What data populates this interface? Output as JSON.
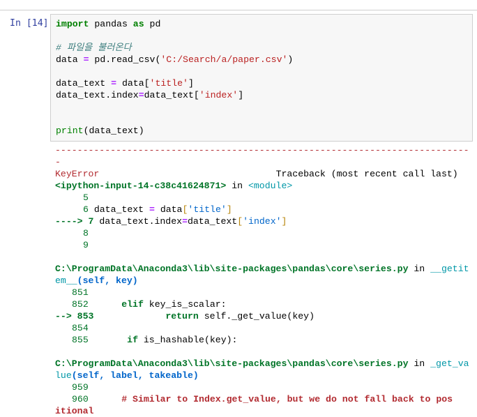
{
  "prompt": "In [14]:",
  "code": {
    "l1_kw1": "import",
    "l1_mod": " pandas ",
    "l1_kw2": "as",
    "l1_alias": " pd",
    "l3_comment": "# 파일을 불러온다",
    "l4_a": "data ",
    "l4_eq": "=",
    "l4_b": " pd.read_csv(",
    "l4_str": "'C:/Search/a/paper.csv'",
    "l4_c": ")",
    "l6_a": "data_text ",
    "l6_eq": "=",
    "l6_b": " data[",
    "l6_str": "'title'",
    "l6_c": "]",
    "l7_a": "data_text.index",
    "l7_eq": "=",
    "l7_b": "data_text[",
    "l7_str": "'index'",
    "l7_c": "]",
    "l10_fn": "print",
    "l10_rest": "(data_text)"
  },
  "traceback": {
    "dashes": "---------------------------------------------------------------------------",
    "dash_tail": "-",
    "error_name": "KeyError",
    "traceback_hdr": "Traceback (most recent call last)",
    "input_loc": "<ipython-input-14-c38c41624871>",
    "in_word": " in ",
    "module": "<module>",
    "f1": [
      {
        "no": "5",
        "code": ""
      },
      {
        "no": "6",
        "code": "data_text = data['title']"
      },
      {
        "no": "7",
        "arrow": "---->",
        "code": "data_text.index=data_text['index']"
      },
      {
        "no": "8",
        "code": ""
      },
      {
        "no": "9",
        "code": ""
      }
    ],
    "path1": "C:\\ProgramData\\Anaconda3\\lib\\site-packages\\pandas\\core\\series.py",
    "fn1_a": "__getit",
    "fn1_b": "em__",
    "sig1": "(self, key)",
    "f2_851": "851",
    "f2_852": "852",
    "f2_852_kw": "elif",
    "f2_852_code": " key_is_scalar:",
    "f2_853_arrow": "-->",
    "f2_853": "853",
    "f2_853_kw": "return",
    "f2_853_code": " self._get_value(key)",
    "f2_854": "854",
    "f2_855": "855",
    "f2_855_kw": "if",
    "f2_855_code": " is_hashable(key):",
    "path2": "C:\\ProgramData\\Anaconda3\\lib\\site-packages\\pandas\\core\\series.py",
    "fn2_a": "_get_va",
    "fn2_b": "lue",
    "sig2": "(self, label, takeable)",
    "f3_959": "959",
    "f3_960": "960",
    "f3_960_comment": "# Similar to Index.get_value, but we do not fall back to pos",
    "f3_tail": "itional"
  }
}
